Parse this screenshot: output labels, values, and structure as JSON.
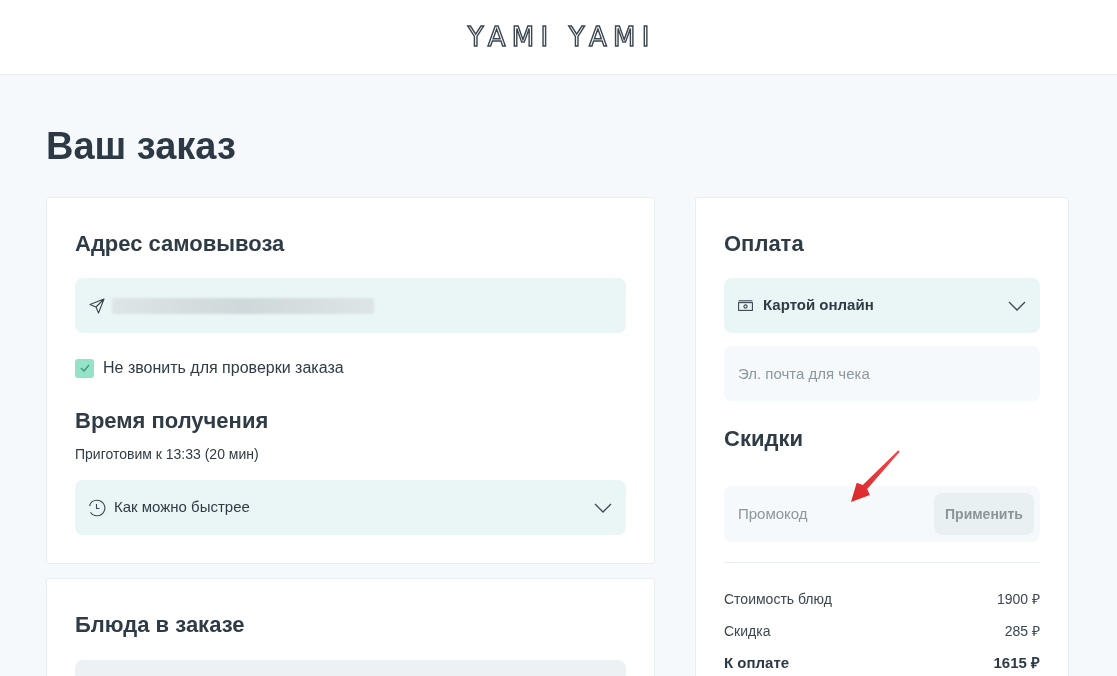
{
  "header": {
    "logo": "YAMI YAMI"
  },
  "page_title": "Ваш заказ",
  "pickup": {
    "title": "Адрес самовывоза",
    "no_call": {
      "label": "Не звонить для проверки заказа",
      "checked": true
    },
    "time_title": "Время получения",
    "time_note": "Приготовим к 13:33 (20 мин)",
    "time_select": {
      "value": "Как можно быстрее"
    }
  },
  "dishes": {
    "title": "Блюда в заказе"
  },
  "payment": {
    "title": "Оплата",
    "method_select": {
      "value": "Картой онлайн"
    },
    "email_field": {
      "placeholder": "Эл. почта для чека"
    }
  },
  "discounts": {
    "title": "Скидки",
    "promo_field": {
      "placeholder": "Промокод"
    },
    "apply_button": {
      "label": "Применить",
      "disabled": true
    }
  },
  "summary": [
    {
      "kind": "line",
      "label": "Стоимость блюд",
      "value": "1900 ₽"
    },
    {
      "kind": "line",
      "label": "Скидка",
      "value": "285 ₽"
    },
    {
      "kind": "total",
      "label": "К оплате",
      "value": "1615 ₽"
    }
  ]
}
